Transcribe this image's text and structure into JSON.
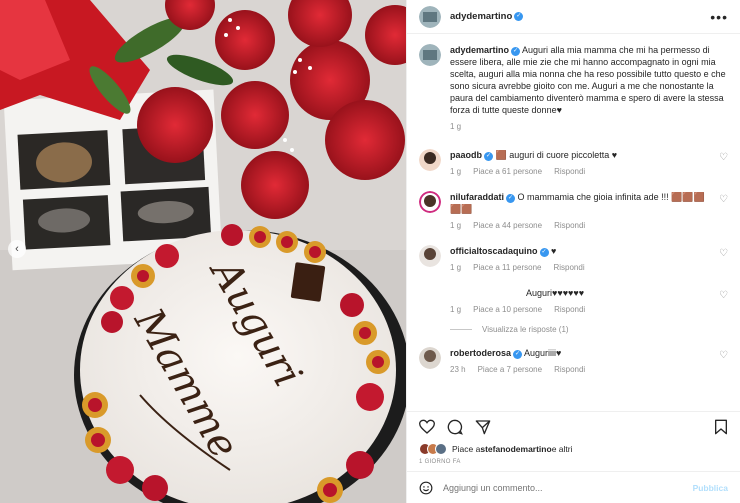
{
  "post": {
    "username": "adydemartino",
    "caption_user": "adydemartino",
    "caption": "Auguri alla mia mamma che mi ha permesso di essere libera, alle mie zie che mi hanno accompagnato in ogni mia scelta, auguri alla mia nonna che ha reso possibile tutto questo e che sono sicura avrebbe gioito con me. Auguri a me che nonostante la paura del cambiamento diventerò mamma e spero di avere la stessa forza di tutte queste donne♥",
    "caption_time": "1 g",
    "icon_more": "more-options-icon"
  },
  "comments": [
    {
      "user": "paaodb",
      "verified": true,
      "text": "🟫 auguri di cuore piccoletta ♥",
      "time": "1 g",
      "likes": "Piace a 61 persone",
      "reply": "Rispondi"
    },
    {
      "user": "nilufaraddati",
      "verified": true,
      "text": "O mammamia che gioia infinita ade !!! 🟫🟫🟫🟫🟫",
      "time": "1 g",
      "likes": "Piace a 44 persone",
      "reply": "Rispondi"
    },
    {
      "user": "officialtoscadaquino",
      "verified": true,
      "text": "♥",
      "time": "1 g",
      "likes": "Piace a 11 persone",
      "reply": "Rispondi"
    },
    {
      "user": "",
      "verified": false,
      "text": "Auguri♥♥♥♥♥♥",
      "time": "1 g",
      "likes": "Piace a 10 persone",
      "reply": "Rispondi"
    },
    {
      "user": "robertoderosa",
      "verified": true,
      "text": "Auguriiii♥",
      "time": "23 h",
      "likes": "Piace a 7 persone",
      "reply": "Rispondi"
    }
  ],
  "view_replies": "Visualizza le risposte (1)",
  "likes_line": {
    "prefix": "Piace a ",
    "user": "stefanodemartino",
    "suffix": " e altri"
  },
  "date": "1 GIORNO FA",
  "add_comment": {
    "placeholder": "Aggiungi un commento...",
    "publish": "Pubblica"
  },
  "photo": {
    "cake_text_1": "Auguri",
    "cake_text_2": "Mamme"
  },
  "colors": {
    "accent": "#3897f0",
    "publish_disabled": "#b2dffc",
    "muted": "#8e8e8e"
  }
}
